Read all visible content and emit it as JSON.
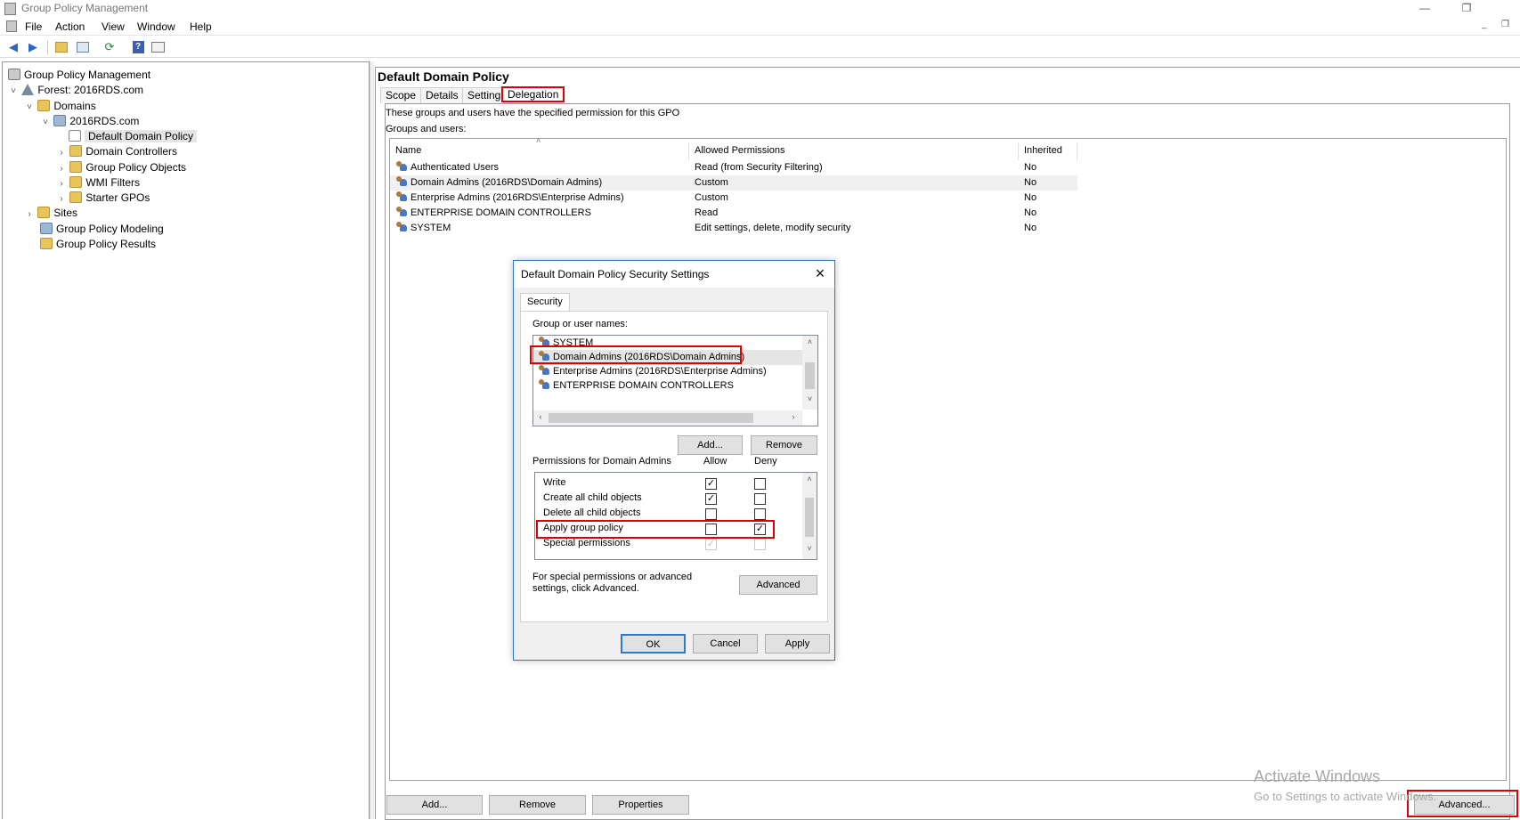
{
  "window": {
    "title": "Group Policy Management",
    "controls": {
      "minimize": "—",
      "restore": "❐"
    }
  },
  "menu": [
    "File",
    "Action",
    "View",
    "Window",
    "Help"
  ],
  "tree": {
    "root": "Group Policy Management",
    "forest": "Forest: 2016RDS.com",
    "domains": "Domains",
    "domain": "2016RDS.com",
    "default_policy": "Default Domain Policy",
    "domain_controllers": "Domain Controllers",
    "gpo": "Group Policy Objects",
    "wmi": "WMI Filters",
    "starter": "Starter GPOs",
    "sites": "Sites",
    "modeling": "Group Policy Modeling",
    "results": "Group Policy Results"
  },
  "details": {
    "title": "Default Domain Policy",
    "tabs": [
      "Scope",
      "Details",
      "Settings",
      "Delegation"
    ],
    "active_tab": "Delegation",
    "description": "These groups and users have the specified permission for this GPO",
    "groups_label": "Groups and users:",
    "columns": [
      "Name",
      "Allowed Permissions",
      "Inherited"
    ],
    "rows": [
      {
        "name": "Authenticated Users",
        "perm": "Read (from Security Filtering)",
        "inherited": "No"
      },
      {
        "name": "Domain Admins (2016RDS\\Domain Admins)",
        "perm": "Custom",
        "inherited": "No"
      },
      {
        "name": "Enterprise Admins (2016RDS\\Enterprise Admins)",
        "perm": "Custom",
        "inherited": "No"
      },
      {
        "name": "ENTERPRISE DOMAIN CONTROLLERS",
        "perm": "Read",
        "inherited": "No"
      },
      {
        "name": "SYSTEM",
        "perm": "Edit settings, delete, modify security",
        "inherited": "No"
      }
    ],
    "buttons": {
      "add": "Add...",
      "remove": "Remove",
      "properties": "Properties",
      "advanced": "Advanced..."
    }
  },
  "watermark": {
    "line1": "Activate Windows",
    "line2": "Go to Settings to activate Windows."
  },
  "dialog": {
    "title": "Default Domain Policy Security Settings",
    "tab": "Security",
    "group_label": "Group or user names:",
    "users": [
      "SYSTEM",
      "Domain Admins (2016RDS\\Domain Admins)",
      "Enterprise Admins (2016RDS\\Enterprise Admins)",
      "ENTERPRISE DOMAIN CONTROLLERS"
    ],
    "add": "Add...",
    "remove": "Remove",
    "perm_label": "Permissions for Domain Admins",
    "allow": "Allow",
    "deny": "Deny",
    "permissions": [
      {
        "name": "Write",
        "allow": true,
        "deny": false,
        "disabled": false
      },
      {
        "name": "Create all child objects",
        "allow": true,
        "deny": false,
        "disabled": false
      },
      {
        "name": "Delete all child objects",
        "allow": false,
        "deny": false,
        "disabled": false
      },
      {
        "name": "Apply group policy",
        "allow": false,
        "deny": true,
        "disabled": false
      },
      {
        "name": "Special permissions",
        "allow": true,
        "deny": false,
        "disabled": true
      }
    ],
    "special_text": "For special permissions or advanced settings, click Advanced.",
    "advanced": "Advanced",
    "ok": "OK",
    "cancel": "Cancel",
    "apply": "Apply"
  },
  "colors": {
    "highlight": "#e00000",
    "dialog_border": "#2b7ad0",
    "check_glyph": "✓"
  }
}
